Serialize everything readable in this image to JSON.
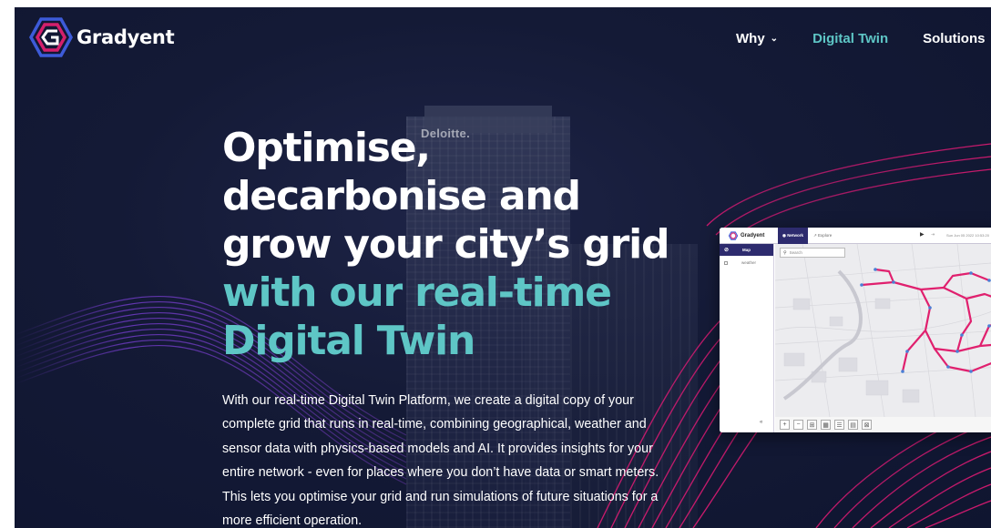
{
  "brand": {
    "name": "Gradyent"
  },
  "nav": {
    "items": [
      {
        "label": "Why",
        "chevron": "chevron-down-icon",
        "active": false
      },
      {
        "label": "Digital Twin",
        "active": true
      },
      {
        "label": "Solutions",
        "chevron": "chevron-down-icon",
        "active": false
      }
    ]
  },
  "hero": {
    "title_line1": "Optimise,",
    "title_line2": "decarbonise and",
    "title_line3": "grow your city’s grid",
    "title_accent1": "with our real-time",
    "title_accent2": "Digital Twin",
    "body_line1": "With our real-time Digital Twin Platform, we create a digital copy of your",
    "body_line2": "complete grid that runs in real-time, combining geographical, weather and",
    "body_line3": "sensor data with physics-based models and AI. It provides insights for your",
    "body_line4": "entire network - even for places where you don’t have data or smart meters.",
    "body_line5": "This lets you optimise your grid and run simulations of future situations for a",
    "body_line6": "more efficient operation."
  },
  "background": {
    "building_sign": "Deloitte."
  },
  "app_preview": {
    "logo_text": "Gradyent",
    "tab_active": "Network",
    "tab_other": "Explore",
    "date_text": "Sun Jun 05 2022 10:53:20",
    "sidebar_title": "Map",
    "sidebar_row": "weather",
    "search_placeholder": "Search",
    "collapse_icon": "double-chevron-left-icon",
    "tools": [
      "+",
      "−",
      "⊞",
      "▦",
      "☰",
      "▤",
      "⊠"
    ]
  },
  "colors": {
    "accent": "#5ec6c6",
    "background": "#141a36",
    "wave_magenta": "#d6176e",
    "wave_purple": "#7a3fd6",
    "app_navy": "#2d2b6e"
  }
}
